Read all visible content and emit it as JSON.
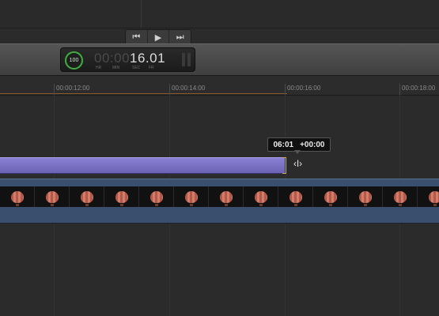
{
  "transport": {
    "prev_icon": "skip-back-icon",
    "play_icon": "play-icon",
    "next_icon": "skip-forward-icon"
  },
  "timecode": {
    "gauge_value": "100",
    "dim_digits": "00:00",
    "bright_digits": "16.01",
    "units": [
      "HR",
      "MIN",
      "SEC",
      "FR"
    ]
  },
  "ruler": {
    "ticks": [
      "00:00:12:00",
      "00:00:14:00",
      "00:00:16:00",
      "00:00:18:00"
    ]
  },
  "tooltip": {
    "position": "06:01",
    "delta": "+00:00"
  },
  "tracks": {
    "video_thumbnail_icon": "hot-air-balloon-icon",
    "audio_clip_color": "#7d74c9",
    "video_track_color": "#3a4f6e"
  },
  "colors": {
    "trim_handle": "#e0a830",
    "timecode_gauge": "#3fae3f"
  }
}
